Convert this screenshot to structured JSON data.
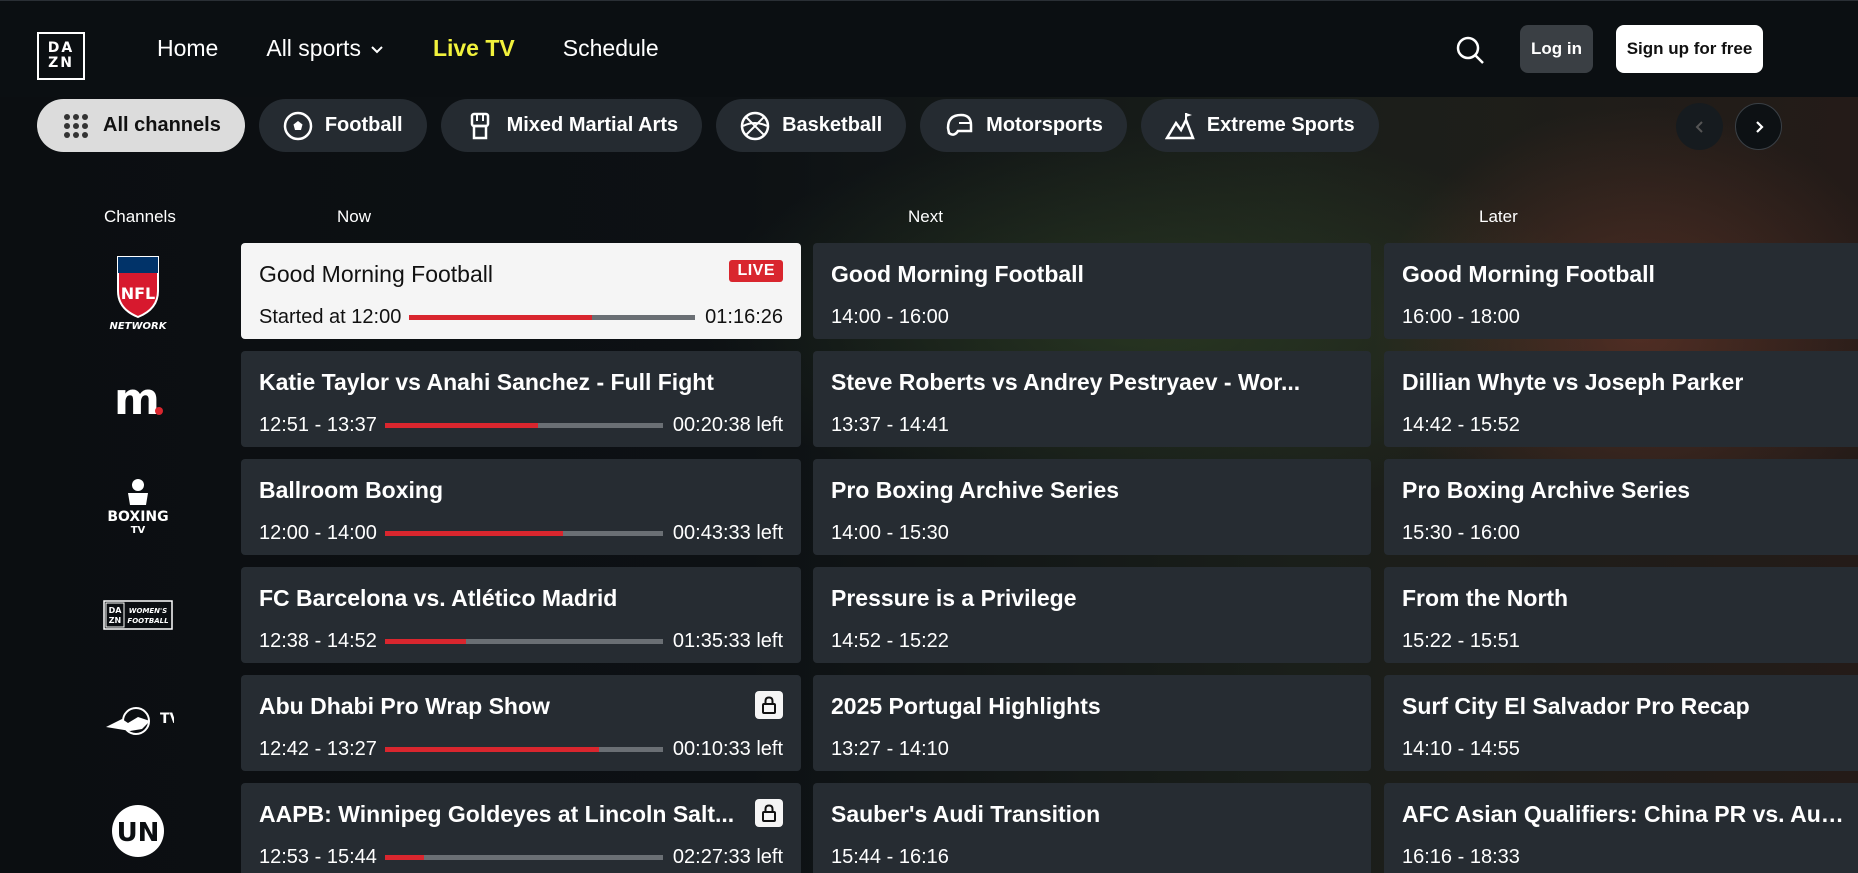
{
  "header": {
    "logo_line1": "DA",
    "logo_line2": "ZN",
    "nav": {
      "home": "Home",
      "all_sports": "All sports",
      "live_tv": "Live TV",
      "schedule": "Schedule"
    },
    "login": "Log in",
    "signup": "Sign up for free"
  },
  "filters": [
    {
      "label": "All channels",
      "icon": "grid-icon",
      "selected": true
    },
    {
      "label": "Football",
      "icon": "soccer-ball-icon"
    },
    {
      "label": "Mixed Martial Arts",
      "icon": "fist-icon"
    },
    {
      "label": "Basketball",
      "icon": "basketball-icon"
    },
    {
      "label": "Motorsports",
      "icon": "helmet-icon"
    },
    {
      "label": "Extreme Sports",
      "icon": "mountain-icon"
    }
  ],
  "columns": {
    "channels": "Channels",
    "now": "Now",
    "next": "Next",
    "later": "Later"
  },
  "colors": {
    "accent_yellow": "#f2f23c",
    "live_red": "#d9262e",
    "cell_bg": "#262c32"
  },
  "rows": [
    {
      "channel": {
        "name": "NFL Network",
        "logo_top": "NFL",
        "logo_bottom": "NETWORK"
      },
      "now": {
        "title": "Good Morning Football",
        "time": "Started at 12:00",
        "remaining": "01:16:26",
        "progress": 0.64,
        "live": true,
        "live_label": "LIVE"
      },
      "next": {
        "title": "Good Morning Football",
        "time": "14:00 - 16:00"
      },
      "later": {
        "title": "Good Morning Football",
        "time": "16:00 - 18:00"
      }
    },
    {
      "channel": {
        "name": "m.",
        "logo_text": "m"
      },
      "now": {
        "title": "Katie Taylor vs Anahi Sanchez - Full Fight",
        "time": "12:51 - 13:37",
        "remaining": "00:20:38 left",
        "progress": 0.55
      },
      "next": {
        "title": "Steve Roberts vs Andrey Pestryaev - Wor...",
        "time": "13:37 - 14:41"
      },
      "later": {
        "title": "Dillian Whyte vs Joseph Parker",
        "time": "14:42 - 15:52"
      }
    },
    {
      "channel": {
        "name": "Boxing TV",
        "logo_text": "BOXING",
        "logo_sub": "TV"
      },
      "now": {
        "title": "Ballroom Boxing",
        "time": "12:00 - 14:00",
        "remaining": "00:43:33 left",
        "progress": 0.64
      },
      "next": {
        "title": "Pro Boxing Archive Series",
        "time": "14:00 - 15:30"
      },
      "later": {
        "title": "Pro Boxing Archive Series",
        "time": "15:30 - 16:00"
      }
    },
    {
      "channel": {
        "name": "DAZN Women's Football",
        "logo_a": "DA",
        "logo_b": "ZN",
        "logo_c": "WOMEN'S",
        "logo_d": "FOOTBALL"
      },
      "now": {
        "title": "FC Barcelona vs. Atlético Madrid",
        "time": "12:38 - 14:52",
        "remaining": "01:35:33 left",
        "progress": 0.29
      },
      "next": {
        "title": "Pressure is a Privilege",
        "time": "14:52 - 15:22"
      },
      "later": {
        "title": "From the North",
        "time": "15:22 - 15:51"
      }
    },
    {
      "channel": {
        "name": "Red Bull TV",
        "logo_text": "TV"
      },
      "now": {
        "title": "Abu Dhabi Pro Wrap Show",
        "time": "12:42 - 13:27",
        "remaining": "00:10:33 left",
        "progress": 0.77,
        "locked": true
      },
      "next": {
        "title": "2025 Portugal Highlights",
        "time": "13:27 - 14:10"
      },
      "later": {
        "title": "Surf City El Salvador Pro Recap",
        "time": "14:10 - 14:55"
      }
    },
    {
      "channel": {
        "name": "UN",
        "logo_text": "UN"
      },
      "now": {
        "title": "AAPB: Winnipeg Goldeyes at Lincoln Salt...",
        "time": "12:53 - 15:44",
        "remaining": "02:27:33 left",
        "progress": 0.14,
        "locked": true
      },
      "next": {
        "title": "Sauber's Audi Transition",
        "time": "15:44 - 16:16"
      },
      "later": {
        "title": "AFC Asian Qualifiers: China PR vs. Austra...",
        "time": "16:16 - 18:33"
      }
    }
  ]
}
